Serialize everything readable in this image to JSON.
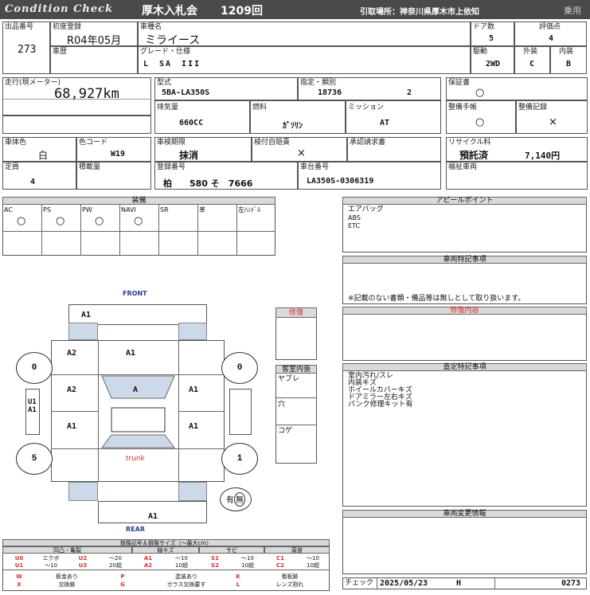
{
  "header": {
    "title": "Condition Check",
    "auction": "厚木入札会",
    "session": "1209回",
    "location": "引取場所：神奈川県厚木市上依知",
    "type": "乗用"
  },
  "info": {
    "lot_label": "出品番号",
    "lot": "273",
    "reg_label": "初度登録",
    "reg": "R04年05月",
    "name_label": "車種名",
    "name": "ミライース",
    "doors_label": "ドア数",
    "doors": "5",
    "score_label": "評価点",
    "score": "4",
    "history_label": "車歴",
    "grade_label": "グレード・仕様",
    "grade": "L　SA　III",
    "drive_label": "駆動",
    "drive": "2WD",
    "ext_label": "外装",
    "ext": "C",
    "int_label": "内装",
    "int": "B",
    "mileage_label": "走行(現メーター)",
    "mileage": "68,927km",
    "model_label": "型式",
    "model": "5BA-LA350S",
    "class_label": "指定・類別",
    "class1": "18736",
    "class2": "2",
    "warranty_label": "保証書",
    "warranty": "○",
    "cc_label": "排気量",
    "cc": "660CC",
    "fuel_label": "燃料",
    "fuel": "ｶﾞｿﾘﾝ",
    "mission_label": "ミッション",
    "mission": "AT",
    "manual_label": "整備手帳",
    "manual": "○",
    "record_label": "整備記録",
    "record": "×",
    "color_label": "車体色",
    "color": "白",
    "ccode_label": "色コード",
    "ccode": "W19",
    "inspect_label": "車検期限",
    "inspect": "抹消",
    "insurance_label": "検付自賠責",
    "insurance": "×",
    "claim_label": "承認請求書",
    "recycle_label": "リサイクル料",
    "recycle_status": "預託済",
    "recycle_fee": "7,140円",
    "capacity_label": "定員",
    "capacity": "4",
    "load_label": "積載量",
    "regno_label": "登録番号",
    "regno": "柏　　580 そ　7666",
    "chassis_label": "車台番号",
    "chassis": "LA350S-0306319",
    "welfare_label": "福祉車両"
  },
  "equipment": {
    "title": "装備",
    "items": [
      {
        "label": "AC",
        "value": "○"
      },
      {
        "label": "PS",
        "value": "○"
      },
      {
        "label": "PW",
        "value": "○"
      },
      {
        "label": "NAVI",
        "value": "○"
      },
      {
        "label": "SR",
        "value": ""
      },
      {
        "label": "革",
        "value": ""
      },
      {
        "label": "左ﾊﾝﾄﾞﾙ",
        "value": ""
      }
    ]
  },
  "diagram": {
    "front": "FRONT",
    "rear": "REAR",
    "trunk": "trunk",
    "codes": {
      "front_bumper": "A1",
      "bonnet_l": "A2",
      "bonnet_r": "A1",
      "fender_l": "A2",
      "glass": "A",
      "fender_r": "A1",
      "door_l": "A1",
      "door_r": "A1",
      "rear_bumper": "A1",
      "side": "U1\nA1"
    },
    "tires": {
      "fl": "0",
      "fr": "0",
      "rl": "5",
      "rr": "1"
    },
    "spare": "有",
    "spare_none": "無"
  },
  "repair_side": {
    "title": "修復",
    "interior_title": "客室内張",
    "interior": [
      "ヤブレ",
      "穴",
      "コゲ"
    ]
  },
  "right": {
    "appeal_title": "アピールポイント",
    "appeal": [
      "エアバッグ",
      "ABS",
      "ETC"
    ],
    "notes_title": "車両特記事項",
    "notes": "※記載のない書類・備品等は無しとして取り扱います。",
    "repair_title": "修復内容",
    "assess_title": "査定特記事項",
    "assess": [
      "室内汚れ/スレ",
      "内装キズ",
      "ホイールカバーキズ",
      "ドアミラー左右キズ",
      "パンク修理キット有"
    ],
    "change_title": "車両変更情報"
  },
  "footer": {
    "check_label": "チェック",
    "date": "2025/05/23",
    "h": "H",
    "num": "0273"
  },
  "legend": {
    "title": "損傷記号＆損傷サイズ（～最大cm）",
    "groups": [
      "凹凸・亀裂",
      "線キズ",
      "サビ",
      "腐食"
    ],
    "rows": [
      [
        [
          "U0",
          "エクボ"
        ],
        [
          "U2",
          "～20"
        ],
        [
          "A1",
          "～10"
        ],
        [
          "S1",
          "～10"
        ],
        [
          "C1",
          "～10"
        ]
      ],
      [
        [
          "U1",
          "～10"
        ],
        [
          "U3",
          "20超"
        ],
        [
          "A2",
          "10超"
        ],
        [
          "S2",
          "10超"
        ],
        [
          "C2",
          "10超"
        ]
      ]
    ],
    "bottom": [
      [
        "W",
        "板金あり"
      ],
      [
        "P",
        "塗装あり"
      ],
      [
        "K",
        "看板跡"
      ],
      [
        "X",
        "交換跡"
      ],
      [
        "G",
        "ガラス交換要す"
      ],
      [
        "L",
        "レンズ割れ"
      ]
    ]
  },
  "colors": {
    "header_bg": "#4a4a4a",
    "accent_red": "#d43030",
    "blue_fill": "#cdd9e9"
  }
}
